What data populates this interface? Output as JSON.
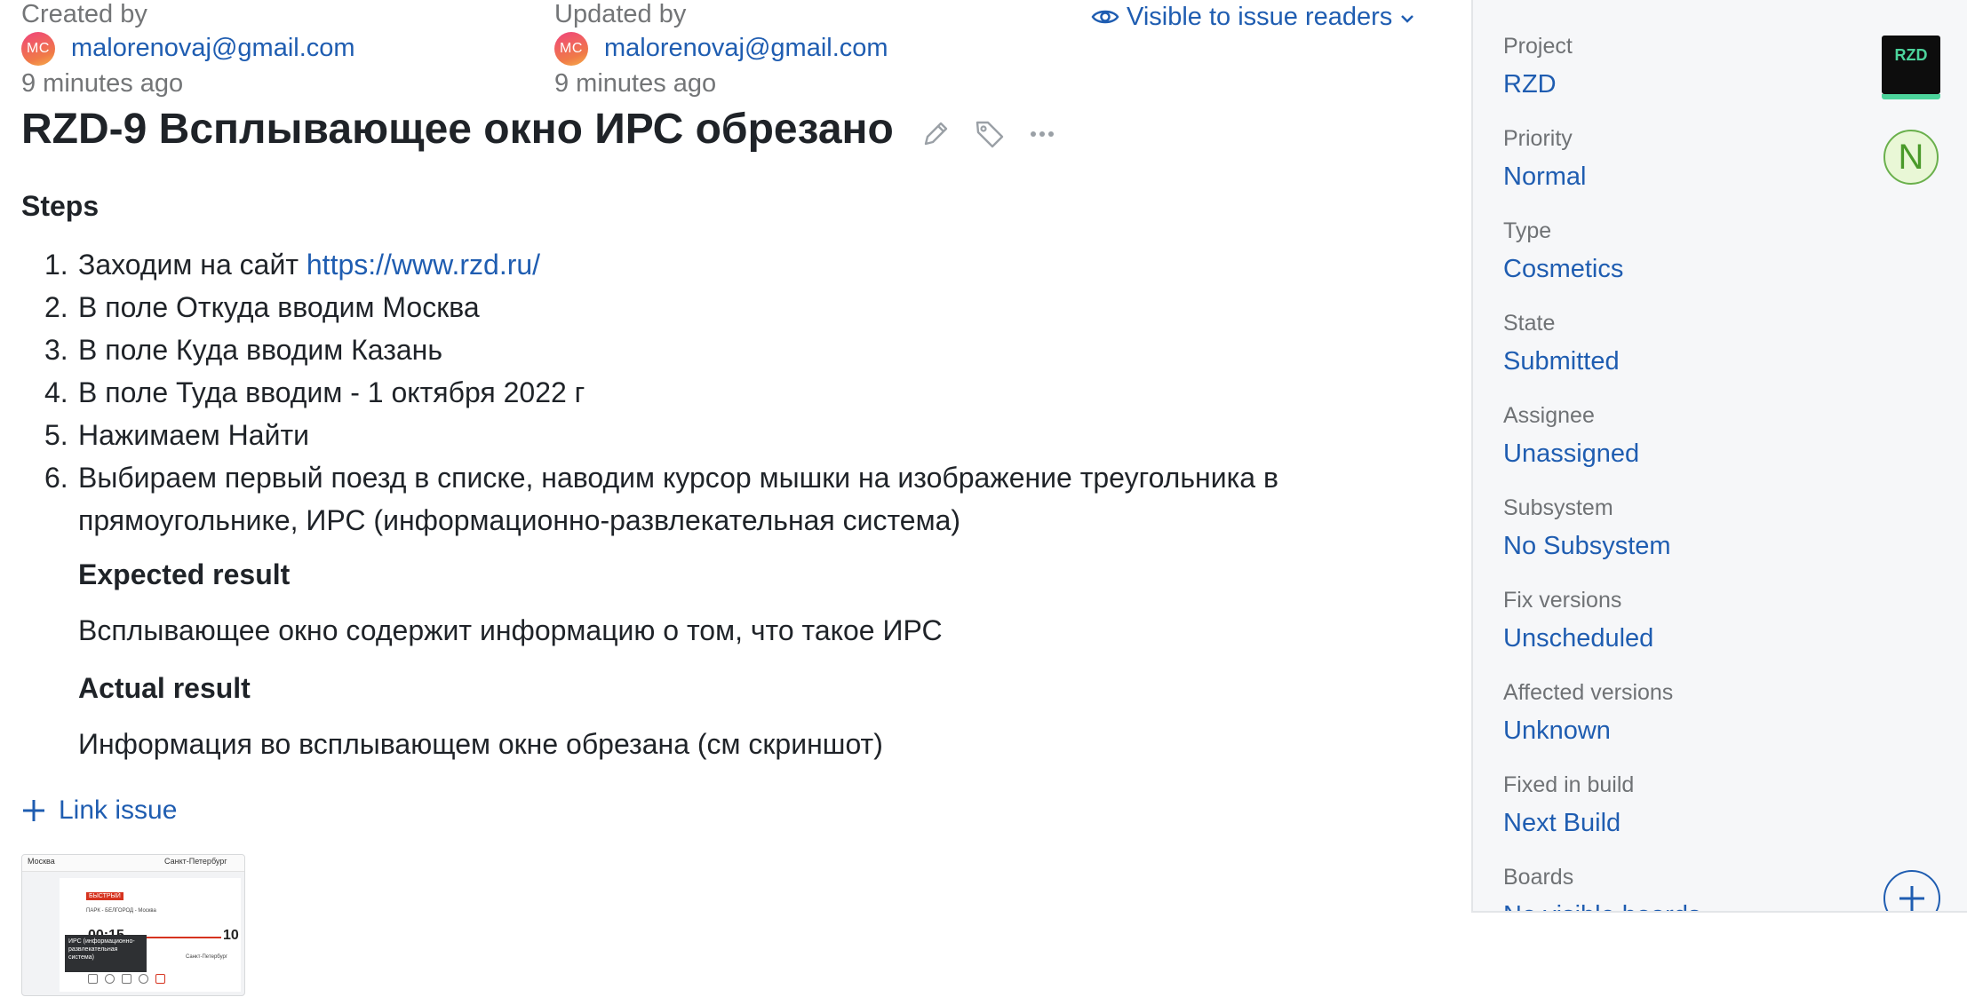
{
  "issue": {
    "created_label": "Created by",
    "created_user": "malorenovaj@gmail.com",
    "created_initials": "MC",
    "created_time": "9 minutes ago",
    "updated_label": "Updated by",
    "updated_user": "malorenovaj@gmail.com",
    "updated_initials": "MC",
    "updated_time": "9 minutes ago",
    "visibility": "Visible to issue readers",
    "title": "RZD-9 Всплывающее окно ИРС обрезано"
  },
  "description": {
    "steps_heading": "Steps",
    "steps": [
      {
        "num": "1.",
        "text": "Заходим на сайт ",
        "link": "https://www.rzd.ru/"
      },
      {
        "num": "2.",
        "text": "В поле Откуда вводим Москва"
      },
      {
        "num": "3.",
        "text": "В поле Куда вводим Казань"
      },
      {
        "num": "4.",
        "text": "В поле Туда вводим - 1 октября 2022 г"
      },
      {
        "num": "5.",
        "text": "Нажимаем Найти"
      },
      {
        "num": "6.",
        "text": "Выбираем первый поезд в списке, наводим курсор мышки на изображение треугольника в прямоугольнике, ИРС (информационно-развлекательная система)"
      }
    ],
    "expected_heading": "Expected result",
    "expected_text": "Всплывающее окно содержит информацию о том, что такое ИРС",
    "actual_heading": "Actual result",
    "actual_text": "Информация во всплывающем окне обрезана (см скриншот)"
  },
  "actions": {
    "link_issue": "Link issue"
  },
  "attachment": {
    "from_city": "Москва",
    "to_city": "Санкт-Петербург",
    "tag": "БЫСТРЫЙ",
    "route": "ПАРК - БЕЛГОРОД - Москва",
    "dep_time": "00:15",
    "arr_time": "10",
    "tooltip": "ИРС (информационно-развлекательная система)",
    "station": "Санкт-Петербург"
  },
  "sidebar": {
    "project_badge": "RZD",
    "priority_letter": "N",
    "fields": [
      {
        "label": "Project",
        "value": "RZD"
      },
      {
        "label": "Priority",
        "value": "Normal"
      },
      {
        "label": "Type",
        "value": "Cosmetics"
      },
      {
        "label": "State",
        "value": "Submitted"
      },
      {
        "label": "Assignee",
        "value": "Unassigned"
      },
      {
        "label": "Subsystem",
        "value": "No Subsystem"
      },
      {
        "label": "Fix versions",
        "value": "Unscheduled"
      },
      {
        "label": "Affected versions",
        "value": "Unknown"
      },
      {
        "label": "Fixed in build",
        "value": "Next Build"
      },
      {
        "label": "Boards",
        "value": "No visible boards"
      }
    ]
  },
  "colors": {
    "link": "#1f5db1",
    "sidebar_bg": "#f6f7f9",
    "priority_green": "#6ab04c",
    "project_badge_text": "#4cd39b"
  },
  "icons": [
    "eye-icon",
    "chevron-down-icon",
    "pencil-icon",
    "tag-icon",
    "more-icon",
    "plus-icon"
  ]
}
